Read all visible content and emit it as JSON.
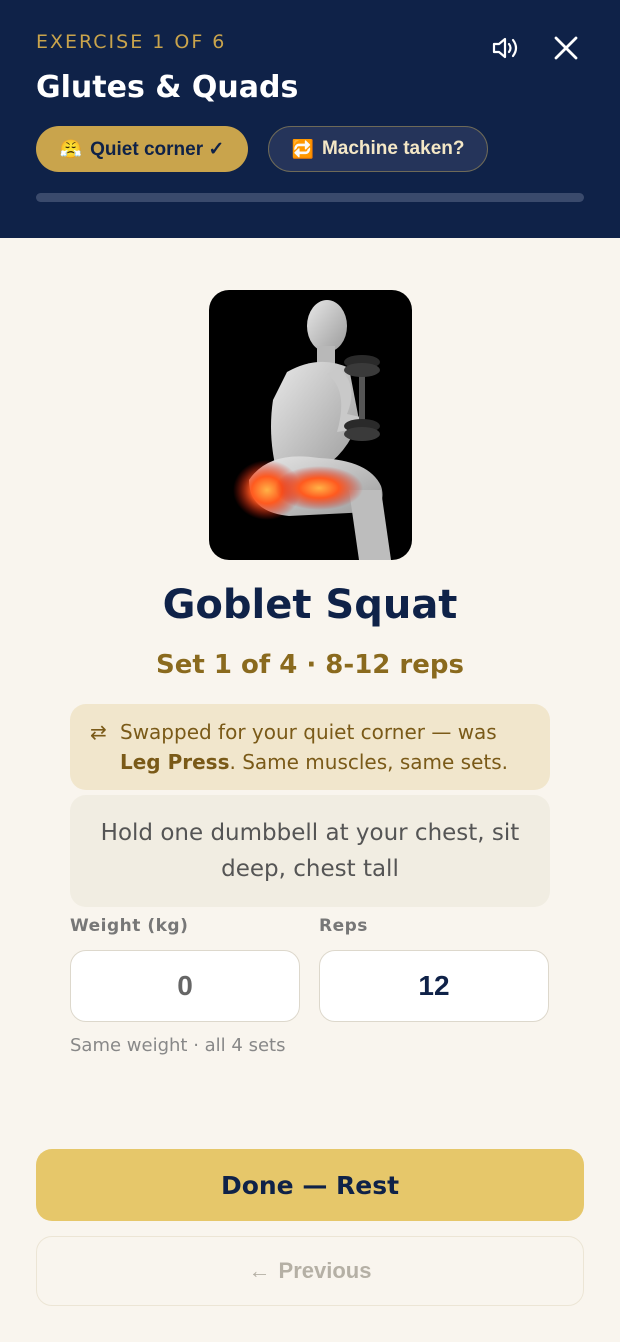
{
  "header": {
    "eyebrow": "EXERCISE 1 OF 6",
    "title": "Glutes & Quads",
    "sound_icon": "speaker-icon",
    "close_icon": "close-icon",
    "quiet_pill": {
      "emoji": "😤",
      "label": "Quiet corner ✓"
    },
    "machine_pill": {
      "emoji": "🔁",
      "label": "Machine taken?"
    },
    "progress": 0
  },
  "exercise": {
    "name": "Goblet Squat",
    "set_line": "Set 1 of 4 · 8-12 reps",
    "swap": {
      "arrow": "⇄",
      "prefix": "Swapped for your quiet corner — was ",
      "original": "Leg Press",
      "suffix": ". Same muscles, same sets."
    },
    "cue": "Hold one dumbbell at your chest, sit deep, chest tall"
  },
  "inputs": {
    "weight_label": "Weight (kg)",
    "weight_value": "0",
    "reps_label": "Reps",
    "reps_value": "12",
    "hint": "Same weight · all 4 sets"
  },
  "actions": {
    "done_label": "Done — Rest",
    "prev_arrow": "←",
    "prev_label": "Previous"
  },
  "colors": {
    "navy": "#0f2248",
    "gold": "#c9a44c",
    "cream": "#f9f5ee",
    "done_button": "#e6c76a"
  }
}
